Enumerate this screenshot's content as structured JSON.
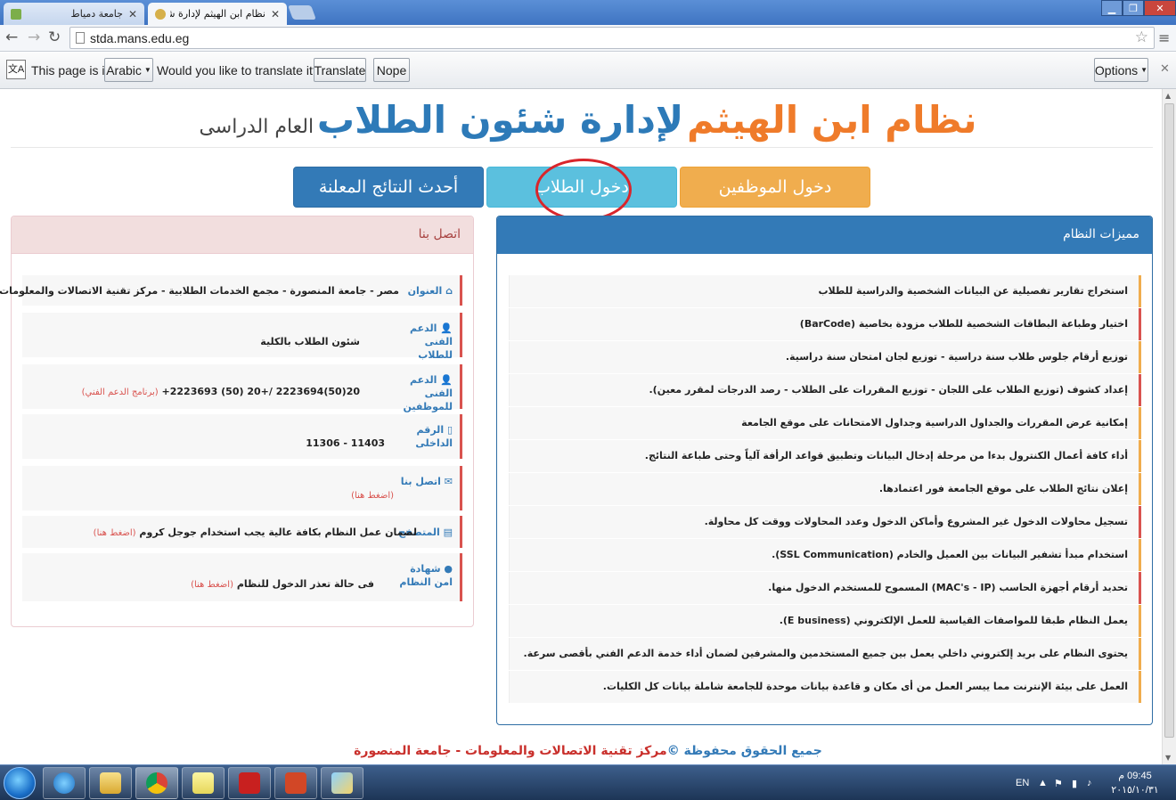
{
  "browser": {
    "tabs": [
      {
        "title": "جامعة دمياط",
        "active": false
      },
      {
        "title": "نظام ابن الهيثم لإدارة شئون الطلاب",
        "active": true
      }
    ],
    "url": "stda.mans.edu.eg"
  },
  "translate_bar": {
    "text_prefix": "This page is in",
    "language": "Arabic",
    "question": "Would you like to translate it?",
    "translate_label": "Translate",
    "nope_label": "Nope",
    "options_label": "Options"
  },
  "header": {
    "title_part1": "نظام ابن الهيثم",
    "title_part2": "لإدارة شئون الطلاب",
    "title_part3": "العام الدراسى"
  },
  "nav_buttons": {
    "staff_login": "دخول الموظفين",
    "student_login": "دخول الطلاب",
    "latest_results": "أحدث النتائج المعلنة"
  },
  "features_panel": {
    "heading": "مميزات النظام",
    "items": [
      "استخراج تقارير تفصيلية عن البيانات الشخصية والدراسية للطلاب",
      "اختيار وطباعة البطاقات الشخصية للطلاب مزودة بخاصية (BarCode)",
      "توزيع أرقام جلوس طلاب سنة دراسية - توزيع لجان امتحان سنة دراسية.",
      "إعداد كشوف (توزيع الطلاب على اللجان - توزيع المقررات على الطلاب - رصد الدرجات لمقرر معين).",
      "إمكانية عرض المقررات والجداول الدراسية وجداول الامتحانات على موقع الجامعة",
      "أداء كافة أعمال الكنترول بدءا من مرحلة إدخال البيانات وتطبيق قواعد الرأفة آلياً وحتى طباعة النتائج.",
      "إعلان نتائج الطلاب على موقع الجامعة فور اعتمادها.",
      "تسجيل محاولات الدخول غير المشروع وأماكن الدخول وعدد المحاولات ووقت كل محاولة.",
      "استخدام مبدأ تشفير البيانات بين العميل والخادم (SSL Communication).",
      "تحديد أرقام أجهزة الحاسب (MAC's - IP) المسموح للمستخدم الدخول منها.",
      "يعمل النظام طبقا للمواصفات القياسية للعمل الإلكتروني (E business).",
      "يحتوى النظام على بريد إلكتروني داخلي يعمل بين جميع المستخدمين والمشرفين لضمان أداء خدمة الدعم الفني بأقصى سرعة.",
      "العمل على بيئة الإنترنت مما ييسر العمل من أى مكان و قاعدة بيانات موحدة للجامعة شاملة بيانات كل الكليات."
    ]
  },
  "contact_panel": {
    "heading": "اتصل بنا",
    "rows": [
      {
        "icon": "⌂",
        "label": "العنوان",
        "value": "مصر - جامعة المنصورة - مجمع الخدمات الطلابية - مركز تقنية الاتصالات والمعلومات",
        "hint": ""
      },
      {
        "icon": "👤",
        "label": "الدعم الفنى للطلاب",
        "value": "شئون الطلاب بالكلية",
        "hint": ""
      },
      {
        "icon": "👤",
        "label": "الدعم الفنى للموظفين",
        "value": "+20(50)2223694 /+20 (50) 2223693",
        "hint": "(برنامج الدعم الفني)"
      },
      {
        "icon": "▯",
        "label": "الرقم الداخلى",
        "value": "11306 - 11403",
        "hint": ""
      },
      {
        "icon": "✉",
        "label": "اتصل بنا",
        "value": "",
        "hint": "(اضغط هنا)"
      },
      {
        "icon": "▤",
        "label": "المتصفح",
        "value": "لضمان عمل النظام بكافة عالية يجب استخدام جوجل كروم",
        "hint": "(اضغط هنا)"
      },
      {
        "icon": "●",
        "label": "شهادة امن النظام",
        "value": "فى حالة تعذر الدخول للنظام",
        "hint": "(اضغط هنا)"
      }
    ]
  },
  "footer": {
    "rights": "جميع الحقوق محفوظة ©",
    "org": "مركز تقنية الاتصالات والمعلومات - جامعة المنصورة"
  },
  "taskbar": {
    "lang": "EN",
    "time": "09:45 م",
    "date": "٢٠١٥/١٠/٣١"
  },
  "colors": {
    "accent_orange": "#f0ad4e",
    "accent_info": "#5bc0de",
    "accent_primary": "#337ab7",
    "annotation_red": "#d9252b"
  }
}
